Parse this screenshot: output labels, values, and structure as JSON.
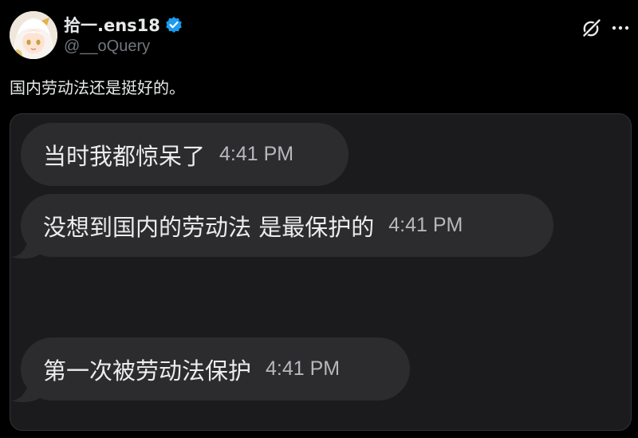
{
  "post": {
    "author": {
      "display_name": "拾一.ens18",
      "handle": "@__oQuery",
      "verified": true,
      "avatar_icon": "anime-girl-avatar"
    },
    "text": "国内劳动法还是挺好的。",
    "header_icons": [
      "grok-icon",
      "more-icon"
    ]
  },
  "media": {
    "messages": [
      {
        "text": "当时我都惊呆了",
        "time": "4:41 PM"
      },
      {
        "text": "没想到国内的劳动法 是最保护的",
        "time": "4:41 PM"
      },
      {
        "text": "第一次被劳动法保护",
        "time": "4:41 PM"
      }
    ]
  },
  "colors": {
    "background": "#000000",
    "text": "#e7e9ea",
    "secondary_text": "#71767b",
    "verified_badge": "#1d9bf0",
    "media_background": "#1b1b1d",
    "bubble": "#2c2c2e"
  }
}
